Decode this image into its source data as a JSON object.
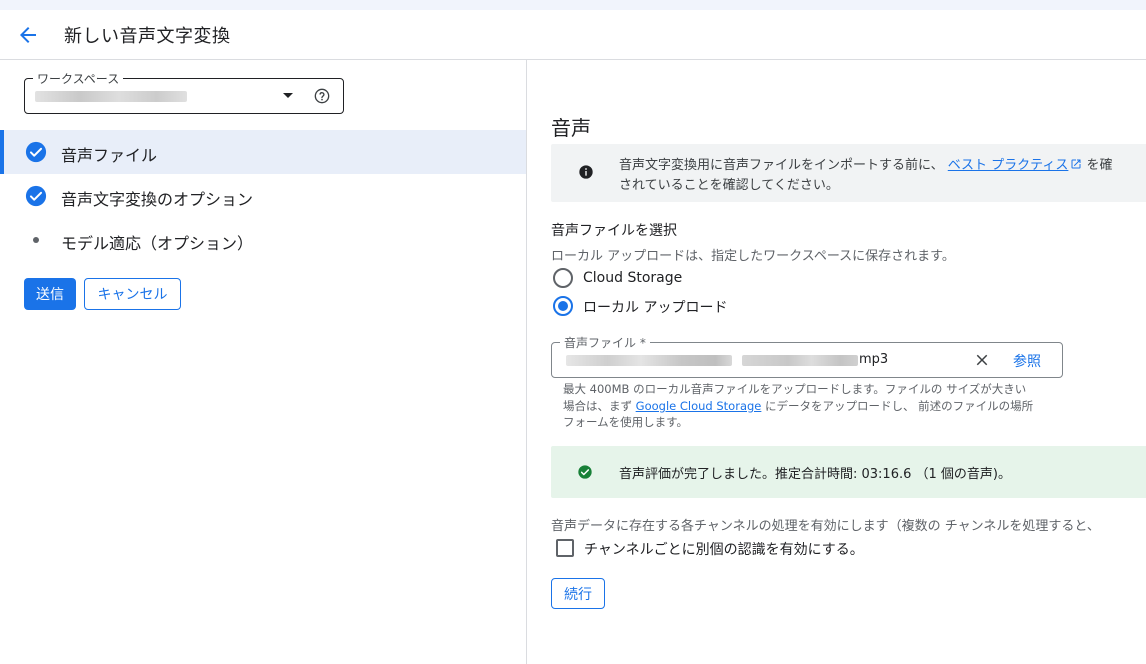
{
  "header": {
    "back_icon": "arrow-back-icon",
    "title": "新しい音声文字変換"
  },
  "workspace": {
    "label": "ワークスペース",
    "value_redacted": true
  },
  "steps": [
    {
      "label": "音声ファイル",
      "status": "done",
      "active": true
    },
    {
      "label": "音声文字変換のオプション",
      "status": "done",
      "active": false
    },
    {
      "label": "モデル適応（オプション）",
      "status": "pending",
      "active": false
    }
  ],
  "actions": {
    "submit": "送信",
    "cancel": "キャンセル"
  },
  "audio": {
    "title": "音声",
    "info_prefix": "音声文字変換用に音声ファイルをインポートする前に、",
    "info_link": "ベスト プラクティス",
    "info_suffix": "を確",
    "info_line2": "されていることを確認してください。",
    "select_title": "音声ファイルを選択",
    "select_desc": "ローカル アップロードは、指定したワークスペースに保存されます。",
    "options": [
      {
        "label": "Cloud Storage",
        "selected": false
      },
      {
        "label": "ローカル アップロード",
        "selected": true
      }
    ],
    "file_label": "音声ファイル *",
    "file_ext": "mp3",
    "browse": "参照",
    "hint_line1": "最大 400MB のローカル音声ファイルをアップロードします。ファイルの サイズが大きい",
    "hint_line2_prefix": "場合は、まず ",
    "hint_link": "Google Cloud Storage",
    "hint_line2_suffix": " にデータをアップロードし、 前述のファイルの場所",
    "hint_line3": "フォームを使用します。",
    "success_text": "音声評価が完了しました。推定合計時間: 03:16.6 （1 個の音声)。",
    "channel_desc": "音声データに存在する各チャンネルの処理を有効にします（複数の チャンネルを処理すると、",
    "channel_checkbox": "チャンネルごとに別個の認識を有効にする。",
    "continue": "続行"
  },
  "colors": {
    "accent": "#1a73e8",
    "success": "#188038",
    "active_step_bg": "#e8eef9"
  }
}
